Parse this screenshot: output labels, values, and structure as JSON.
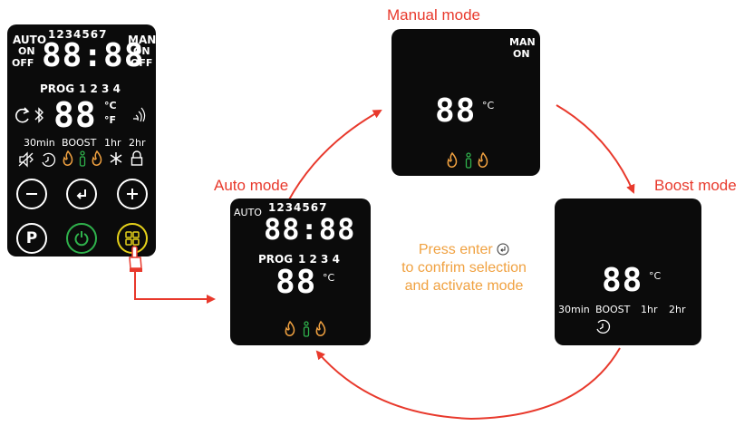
{
  "controller": {
    "auto": "AUTO",
    "prog_digits": "1234567",
    "man": "MAN",
    "on_left": "ON",
    "off_left": "OFF",
    "on_right": "ON",
    "off_right": "OFF",
    "clock": "88:88",
    "prog_label": "PROG",
    "prog_numbers": "1 2 3 4",
    "temp": "88",
    "unit_c": "°C",
    "unit_f": "°F",
    "time_30": "30min",
    "boost": "BOOST",
    "time_1hr": "1hr",
    "time_2hr": "2hr",
    "p_button": "P"
  },
  "manual_mode": {
    "title": "Manual mode",
    "man": "MAN",
    "on": "ON",
    "temp": "88",
    "unit": "°C"
  },
  "auto_mode": {
    "title": "Auto mode",
    "auto": "AUTO",
    "prog_digits": "1234567",
    "clock": "88:88",
    "prog_label": "PROG",
    "prog_numbers": "1 2 3 4",
    "temp": "88",
    "unit": "°C"
  },
  "boost_mode": {
    "title": "Boost mode",
    "temp": "88",
    "unit": "°C",
    "time_30": "30min",
    "boost": "BOOST",
    "time_1hr": "1hr",
    "time_2hr": "2hr"
  },
  "instruction": {
    "line1": "Press enter",
    "line2": "to confrim selection",
    "line3": "and activate mode"
  },
  "colors": {
    "arrow": "#e8392c",
    "flame": "#f0a140",
    "person": "#2fb24c",
    "power": "#2fb24c",
    "menu": "#e6d21a"
  }
}
